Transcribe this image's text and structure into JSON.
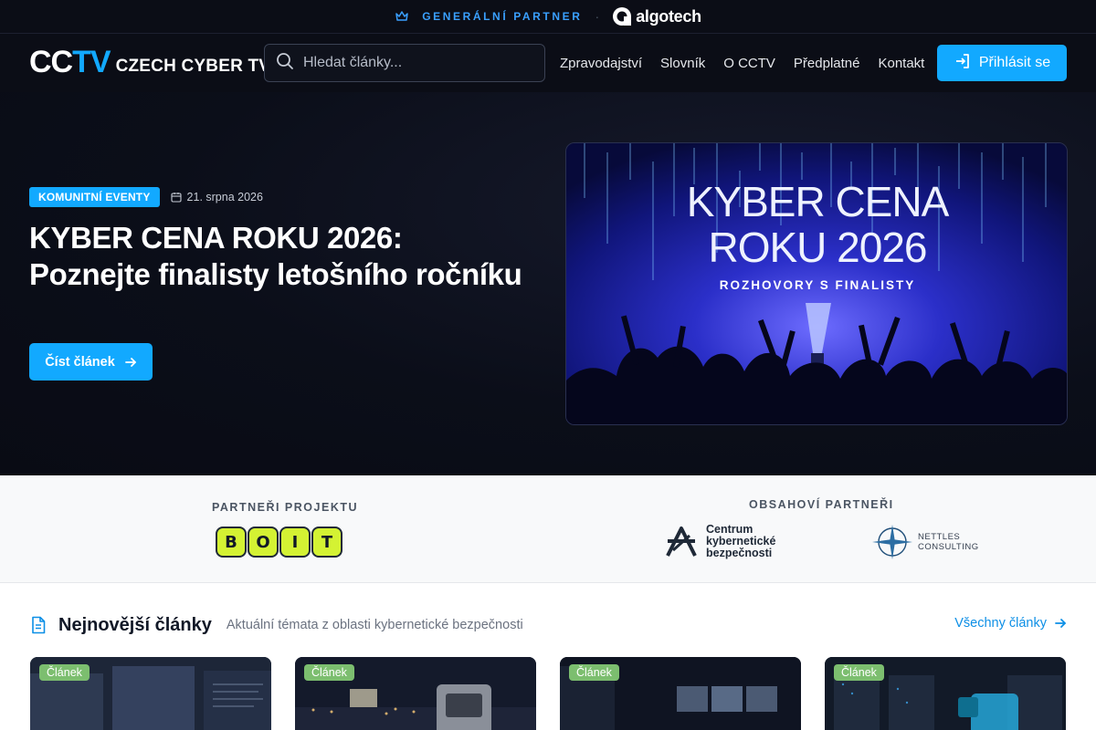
{
  "topbar": {
    "label": "GENERÁLNÍ PARTNER",
    "separator": "·",
    "partner_name": "algotech"
  },
  "nav": {
    "logo_cc": "CC",
    "logo_tv": "TV",
    "logo_name": "CZECH CYBER TV",
    "search_placeholder": "Hledat články...",
    "links": [
      "Zpravodajství",
      "Slovník",
      "O CCTV",
      "Předplatné",
      "Kontakt"
    ],
    "login_label": "Přihlásit se"
  },
  "hero": {
    "category": "KOMUNITNÍ EVENTY",
    "date": "21. srpna 2026",
    "title": "KYBER CENA ROKU 2026: Poznejte finalisty letošního ročníku",
    "cta_label": "Číst článek",
    "image": {
      "line1": "KYBER CENA",
      "line2": "ROKU 2026",
      "line3": "ROZHOVORY S FINALISTY"
    }
  },
  "partners": {
    "project_label": "PARTNEŘI PROJEKTU",
    "project_logo_letters": [
      "B",
      "O",
      "I",
      "T"
    ],
    "content_label": "OBSAHOVÍ PARTNEŘI",
    "ckb_lines": [
      "Centrum",
      "kybernetické",
      "bezpečnosti"
    ],
    "nettles_lines": [
      "NETTLES",
      "CONSULTING"
    ]
  },
  "latest": {
    "title": "Nejnovější články",
    "subtitle": "Aktuální témata z oblasti kybernetické bezpečnosti",
    "all_link": "Všechny články",
    "cards": [
      {
        "badge": "Článek"
      },
      {
        "badge": "Článek"
      },
      {
        "badge": "Článek"
      },
      {
        "badge": "Článek"
      }
    ]
  },
  "colors": {
    "accent": "#12a9ff",
    "dark_bg": "#0b0d16",
    "badge_green": "#7cbe6f",
    "boit_yellow": "#d4f233"
  }
}
